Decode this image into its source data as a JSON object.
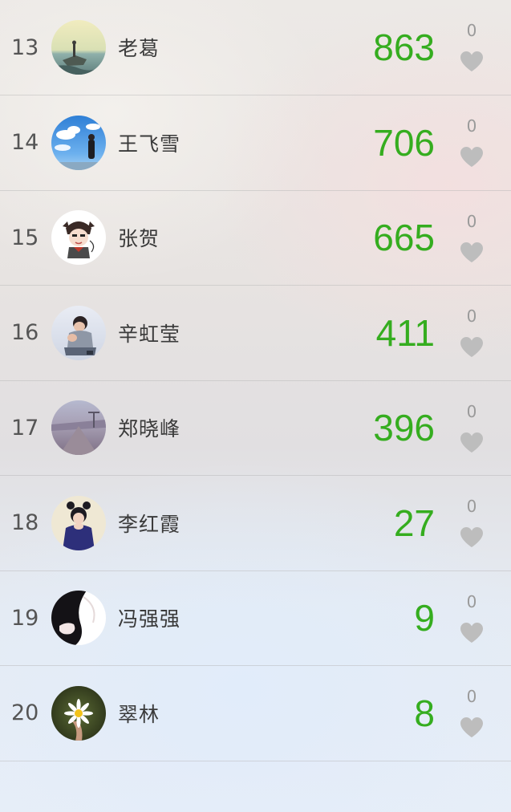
{
  "ranking": {
    "rows": [
      {
        "rank": "13",
        "name": "老葛",
        "score": "863",
        "likes": "0",
        "avatar": "seaside-fishing-photo"
      },
      {
        "rank": "14",
        "name": "王飞雪",
        "score": "706",
        "likes": "0",
        "avatar": "blue-sky-person-photo"
      },
      {
        "rank": "15",
        "name": "张贺",
        "score": "665",
        "likes": "0",
        "avatar": "cartoon-character-photo"
      },
      {
        "rank": "16",
        "name": "辛虹莹",
        "score": "411",
        "likes": "0",
        "avatar": "child-sitting-photo"
      },
      {
        "rank": "17",
        "name": "郑晓峰",
        "score": "396",
        "likes": "0",
        "avatar": "street-scene-photo"
      },
      {
        "rank": "18",
        "name": "李红霞",
        "score": "27",
        "likes": "0",
        "avatar": "girl-with-buns-photo"
      },
      {
        "rank": "19",
        "name": "冯强强",
        "score": "9",
        "likes": "0",
        "avatar": "dark-silhouette-photo"
      },
      {
        "rank": "20",
        "name": "翠林",
        "score": "8",
        "likes": "0",
        "avatar": "daisy-flower-photo"
      }
    ]
  },
  "colors": {
    "score": "#35ad1f",
    "rank": "#555555",
    "heart": "#bdbdbd"
  },
  "icons": {
    "like": "heart-icon"
  }
}
